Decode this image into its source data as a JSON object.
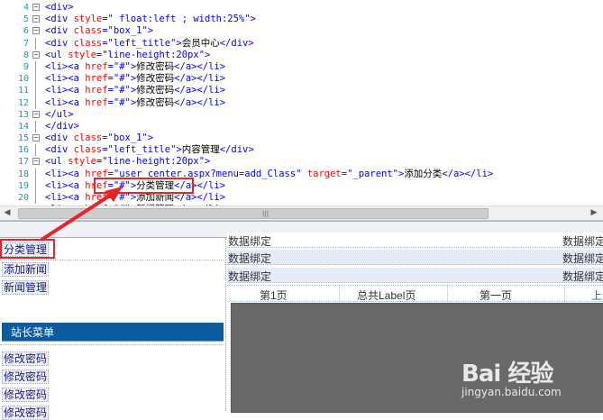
{
  "editor": {
    "lines": [
      {
        "num": "4",
        "fold": "-",
        "parts": [
          [
            "tag",
            "<div>"
          ]
        ]
      },
      {
        "num": "5",
        "fold": "-",
        "parts": [
          [
            "tag",
            "<div "
          ],
          [
            "attr",
            "style"
          ],
          [
            "tag",
            "=\" float:left ; width:25%\">"
          ]
        ]
      },
      {
        "num": "6",
        "fold": "-",
        "parts": [
          [
            "tag",
            "<div "
          ],
          [
            "attr",
            "class"
          ],
          [
            "tag",
            "=\"box_1\">"
          ]
        ]
      },
      {
        "num": "7",
        "fold": "",
        "parts": [
          [
            "tag",
            "<div "
          ],
          [
            "attr",
            "class"
          ],
          [
            "tag",
            "=\"left_title\">"
          ],
          [
            "txt",
            "会员中心"
          ],
          [
            "tag",
            "</div>"
          ]
        ]
      },
      {
        "num": "8",
        "fold": "-",
        "parts": [
          [
            "tag",
            "<ul "
          ],
          [
            "attr",
            "style"
          ],
          [
            "tag",
            "=\"line-height:20px\">"
          ]
        ]
      },
      {
        "num": "9",
        "fold": "",
        "parts": [
          [
            "tag",
            "<li><a "
          ],
          [
            "attr",
            "href"
          ],
          [
            "tag",
            "=\"#\">"
          ],
          [
            "txt",
            "修改密码"
          ],
          [
            "tag",
            "</a></li>"
          ]
        ]
      },
      {
        "num": "10",
        "fold": "",
        "parts": [
          [
            "tag",
            "<li><a "
          ],
          [
            "attr",
            "href"
          ],
          [
            "tag",
            "=\"#\">"
          ],
          [
            "txt",
            "修改密码"
          ],
          [
            "tag",
            "</a></li>"
          ]
        ]
      },
      {
        "num": "11",
        "fold": "",
        "parts": [
          [
            "tag",
            "<li><a "
          ],
          [
            "attr",
            "href"
          ],
          [
            "tag",
            "=\"#\">"
          ],
          [
            "txt",
            "修改密码"
          ],
          [
            "tag",
            "</a></li>"
          ]
        ]
      },
      {
        "num": "12",
        "fold": "",
        "parts": [
          [
            "tag",
            "<li><a "
          ],
          [
            "attr",
            "href"
          ],
          [
            "tag",
            "=\"#\">"
          ],
          [
            "txt",
            "修改密码"
          ],
          [
            "tag",
            "</a></li>"
          ]
        ]
      },
      {
        "num": "13",
        "fold": "-",
        "parts": [
          [
            "tag",
            "</ul>"
          ]
        ]
      },
      {
        "num": "14",
        "fold": "",
        "parts": [
          [
            "tag",
            "</div>"
          ]
        ]
      },
      {
        "num": "15",
        "fold": "-",
        "parts": [
          [
            "tag",
            "<div "
          ],
          [
            "attr",
            "class"
          ],
          [
            "tag",
            "=\"box_1\">"
          ]
        ]
      },
      {
        "num": "16",
        "fold": "",
        "parts": [
          [
            "tag",
            "<div "
          ],
          [
            "attr",
            "class"
          ],
          [
            "tag",
            "=\"left_title\">"
          ],
          [
            "txt",
            "内容管理"
          ],
          [
            "tag",
            "</div>"
          ]
        ]
      },
      {
        "num": "17",
        "fold": "-",
        "parts": [
          [
            "tag",
            "<ul "
          ],
          [
            "attr",
            "style"
          ],
          [
            "tag",
            "=\"line-height:20px\">"
          ]
        ]
      },
      {
        "num": "18",
        "fold": "",
        "parts": [
          [
            "tag",
            "<li><a "
          ],
          [
            "attr",
            "href"
          ],
          [
            "tag",
            "=\"user_center.aspx?menu=add_Class\" "
          ],
          [
            "attr",
            "target"
          ],
          [
            "tag",
            "=\"_parent\">"
          ],
          [
            "txt",
            "添加分类"
          ],
          [
            "tag",
            "</a></li>"
          ]
        ]
      },
      {
        "num": "19",
        "fold": "",
        "parts": [
          [
            "tag",
            "<li><a "
          ],
          [
            "attr",
            "href"
          ],
          [
            "tag",
            "=\"#\">"
          ],
          [
            "txt",
            "分类管理"
          ],
          [
            "tag",
            "</a></li>"
          ]
        ]
      },
      {
        "num": "20",
        "fold": "",
        "parts": [
          [
            "tag",
            "<li><a "
          ],
          [
            "attr",
            "href"
          ],
          [
            "tag",
            "=\"#\">"
          ],
          [
            "txt",
            "添加新闻"
          ],
          [
            "tag",
            "</a></li>"
          ]
        ]
      }
    ],
    "partial_line": "<li><a href=\"#\">新闻管理</a></li>"
  },
  "design": {
    "left_links_top": [
      "分类管理",
      "添加新闻",
      "新闻管理"
    ],
    "menu_title": "站长菜单",
    "left_links_bottom": [
      "修改密码",
      "修改密码",
      "修改密码",
      "修改密码"
    ],
    "grid_rows": [
      {
        "left": "数据绑定",
        "right": "数据绑定"
      },
      {
        "left": "数据绑定",
        "right": "数据绑定"
      },
      {
        "left": "数据绑定",
        "right": "数据绑定"
      }
    ],
    "pager": {
      "first": "第1页",
      "total": "总共Label页",
      "first_page": "第一页",
      "more": "上"
    }
  },
  "watermark": {
    "logo": "Bai 经验",
    "url": "jingyan.baidu.com"
  },
  "colors": {
    "accent_menu": "#0d5b9d",
    "annotation": "#e8242a",
    "tag": "#0000ff",
    "attr": "#ff0000",
    "linenum": "#2b91af"
  }
}
